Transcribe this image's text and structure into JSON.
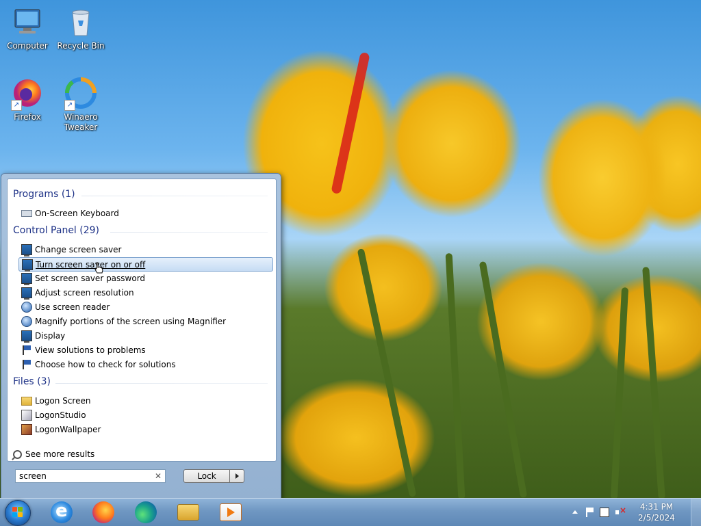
{
  "desktop": {
    "icons": [
      {
        "label": "Computer",
        "icon": "computer-icon"
      },
      {
        "label": "Recycle Bin",
        "icon": "recycle-bin-icon"
      },
      {
        "label": "Firefox",
        "icon": "firefox-icon"
      },
      {
        "label": "Winaero Tweaker",
        "icon": "winaero-tweaker-icon"
      }
    ]
  },
  "start_menu": {
    "groups": {
      "programs": {
        "header": "Programs (1)",
        "items": [
          {
            "label": "On-Screen Keyboard",
            "icon": "keyboard-icon"
          }
        ]
      },
      "control_panel": {
        "header": "Control Panel (29)",
        "items": [
          {
            "label": "Change screen saver",
            "icon": "monitor-icon"
          },
          {
            "label": "Turn screen saver on or off",
            "icon": "monitor-icon",
            "selected": true
          },
          {
            "label": "Set screen saver password",
            "icon": "monitor-icon"
          },
          {
            "label": "Adjust screen resolution",
            "icon": "monitor-icon"
          },
          {
            "label": "Use screen reader",
            "icon": "ease-of-access-icon"
          },
          {
            "label": "Magnify portions of the screen using Magnifier",
            "icon": "ease-of-access-icon"
          },
          {
            "label": "Display",
            "icon": "monitor-icon"
          },
          {
            "label": "View solutions to problems",
            "icon": "action-center-flag-icon"
          },
          {
            "label": "Choose how to check for solutions",
            "icon": "action-center-flag-icon"
          }
        ]
      },
      "files": {
        "header": "Files (3)",
        "items": [
          {
            "label": "Logon Screen",
            "icon": "folder-icon"
          },
          {
            "label": "LogonStudio",
            "icon": "app-icon"
          },
          {
            "label": "LogonWallpaper",
            "icon": "image-icon"
          }
        ]
      }
    },
    "see_more": "See more results",
    "search": {
      "value": "screen"
    },
    "power_button": {
      "label": "Lock"
    }
  },
  "taskbar": {
    "pinned": [
      {
        "name": "Internet Explorer",
        "icon": "internet-explorer-icon"
      },
      {
        "name": "Firefox",
        "icon": "firefox-icon"
      },
      {
        "name": "Microsoft Edge",
        "icon": "edge-icon"
      },
      {
        "name": "Windows Explorer",
        "icon": "file-explorer-icon"
      },
      {
        "name": "Windows Media Player",
        "icon": "media-player-icon"
      }
    ],
    "clock": {
      "time": "4:31 PM",
      "date": "2/5/2024"
    }
  }
}
